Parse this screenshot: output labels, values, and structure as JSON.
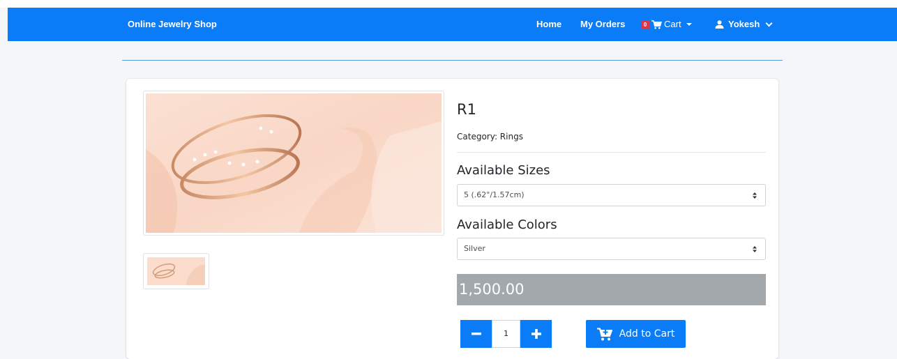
{
  "navbar": {
    "brand": "Online Jewelry Shop",
    "home": "Home",
    "orders": "My Orders",
    "cart_count": "0",
    "cart_label": "Cart",
    "user_name": "Yokesh",
    "bg_color": "#0a7cf8"
  },
  "product": {
    "name": "R1",
    "category": "Category: Rings",
    "sizes_label": "Available Sizes",
    "selected_size": "5 (.62\"/1.57cm)",
    "colors_label": "Available Colors",
    "selected_color": "Silver",
    "price": "1,500.00",
    "quantity": "1",
    "add_to_cart": "Add to Cart"
  },
  "icons": {
    "cart": "cart-icon",
    "user": "user-icon",
    "minus": "minus-icon",
    "plus": "plus-icon",
    "add_cart": "cart-plus-icon"
  }
}
